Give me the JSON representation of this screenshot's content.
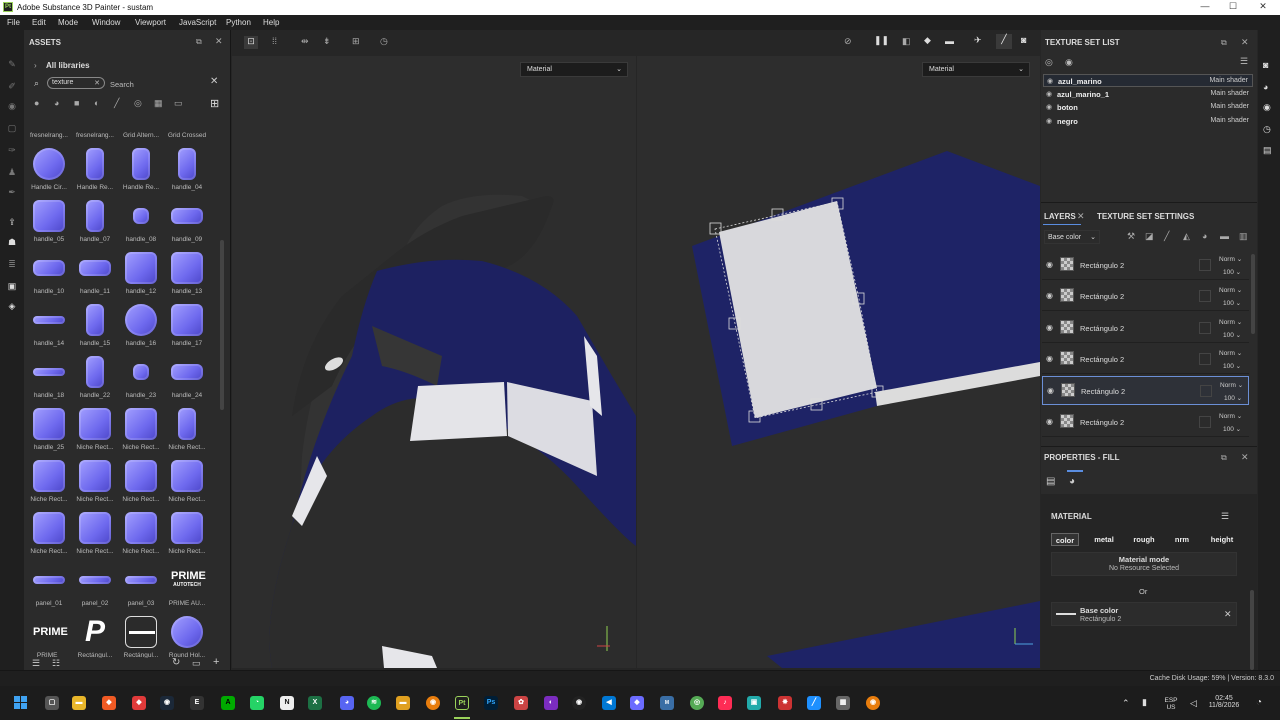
{
  "window": {
    "title": "Adobe Substance 3D Painter - sustam",
    "logo": "Pt"
  },
  "menu": [
    "File",
    "Edit",
    "Mode",
    "Window",
    "Viewport",
    "JavaScript",
    "Python",
    "Help"
  ],
  "assets": {
    "header": "ASSETS",
    "all_libraries": "All libraries",
    "search_tag": "texture",
    "search_placeholder": "Search",
    "tiles": [
      "fresnelrang...",
      "fresnelrang...",
      "Grid Altern...",
      "Grid Crossed",
      "Handle Cir...",
      "Handle Re...",
      "Handle Re...",
      "handle_04",
      "handle_05",
      "handle_07",
      "handle_08",
      "handle_09",
      "handle_10",
      "handle_11",
      "handle_12",
      "handle_13",
      "handle_14",
      "handle_15",
      "handle_16",
      "handle_17",
      "handle_18",
      "handle_22",
      "handle_23",
      "handle_24",
      "handle_25",
      "Niche Rect...",
      "Niche Rect...",
      "Niche Rect...",
      "Niche Rect...",
      "Niche Rect...",
      "Niche Rect...",
      "Niche Rect...",
      "Niche Rect...",
      "Niche Rect...",
      "Niche Rect...",
      "Niche Rect...",
      "panel_01",
      "panel_02",
      "panel_03",
      "PRIME AU...",
      "PRIME_",
      "Rectángul...",
      "Rectángul...",
      "Round Hol..."
    ],
    "prime_logo_text": "PRIME",
    "prime_logo_sub": "AUTOTECH",
    "prime_text": "PRIME"
  },
  "viewport": {
    "dropdown_3d": "Material",
    "dropdown_2d": "Material"
  },
  "texture_set_list": {
    "header": "TEXTURE SET LIST",
    "rows": [
      {
        "name": "azul_marino",
        "shader": "Main shader"
      },
      {
        "name": "azul_marino_1",
        "shader": "Main shader"
      },
      {
        "name": "boton",
        "shader": "Main shader"
      },
      {
        "name": "negro",
        "shader": "Main shader"
      }
    ]
  },
  "layers": {
    "tab_layers": "LAYERS",
    "tab_settings": "TEXTURE SET SETTINGS",
    "channel": "Base color",
    "rows": [
      {
        "name": "Rectángulo 2",
        "blend": "Norm",
        "opacity": "100"
      },
      {
        "name": "Rectángulo 2",
        "blend": "Norm",
        "opacity": "100"
      },
      {
        "name": "Rectángulo 2",
        "blend": "Norm",
        "opacity": "100"
      },
      {
        "name": "Rectángulo 2",
        "blend": "Norm",
        "opacity": "100"
      },
      {
        "name": "Rectángulo 2",
        "blend": "Norm",
        "opacity": "100"
      },
      {
        "name": "Rectángulo 2",
        "blend": "Norm",
        "opacity": "100"
      }
    ],
    "selected_index": 4
  },
  "properties": {
    "header": "PROPERTIES - FILL",
    "section": "MATERIAL",
    "channels": [
      "color",
      "metal",
      "rough",
      "nrm",
      "height"
    ],
    "material_mode_label": "Material mode",
    "material_mode_value": "No Resource Selected",
    "or_label": "Or",
    "base_color_label": "Base color",
    "base_color_value": "Rectángulo 2"
  },
  "status": {
    "text": "Cache Disk Usage:  59% | Version: 8.3.0"
  },
  "taskbar": {
    "lang": "ESP",
    "region": "US",
    "time": "02:45",
    "date": "11/8/2026"
  },
  "colors": {
    "accent": "#5a8de0",
    "navy": "#1f2566",
    "asset": "#7f7af5"
  }
}
